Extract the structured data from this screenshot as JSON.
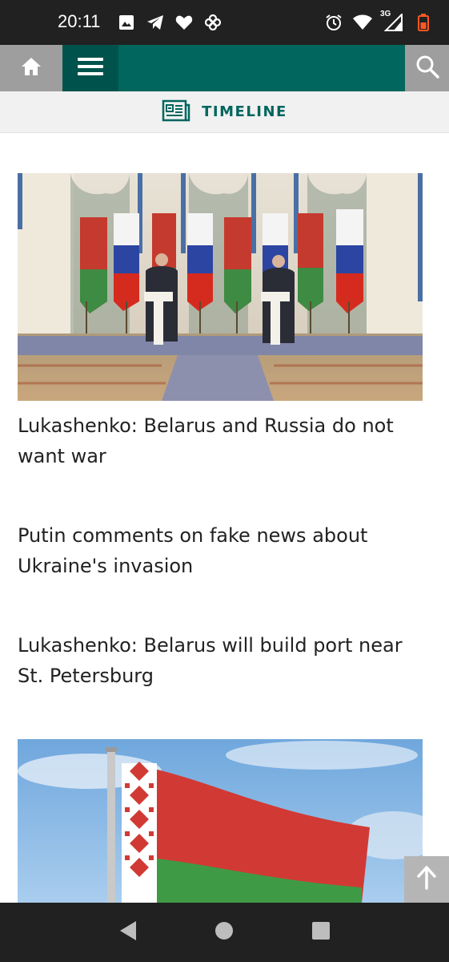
{
  "status_bar": {
    "time": "20:11",
    "network_label": "3G",
    "icons_left": [
      "image-icon",
      "telegram-icon",
      "heart-icon",
      "pinwheel-icon"
    ],
    "icons_right": [
      "alarm-icon",
      "wifi-icon",
      "signal-icon",
      "battery-icon"
    ]
  },
  "header": {
    "home_icon": "home-icon",
    "menu_icon": "hamburger-menu-icon",
    "search_icon": "search-icon",
    "colors": {
      "brand": "#00665e",
      "brand_dark": "#00534c",
      "button_gray": "#9e9e9e"
    }
  },
  "timeline": {
    "label": "TIMELINE",
    "icon": "newspaper-icon"
  },
  "articles": [
    {
      "headline": "Lukashenko: Belarus and Russia do not want war",
      "image": "press-conference-flags-photo"
    },
    {
      "headline": "Putin comments on fake news about Ukraine's invasion"
    },
    {
      "headline": "Lukashenko: Belarus will build port near St. Petersburg"
    },
    {
      "headline": "",
      "image": "belarus-flag-photo"
    }
  ],
  "scroll_top": {
    "icon": "arrow-up-icon"
  },
  "nav_bar": {
    "icons": [
      "back-icon",
      "home-circle-icon",
      "recents-icon"
    ]
  }
}
